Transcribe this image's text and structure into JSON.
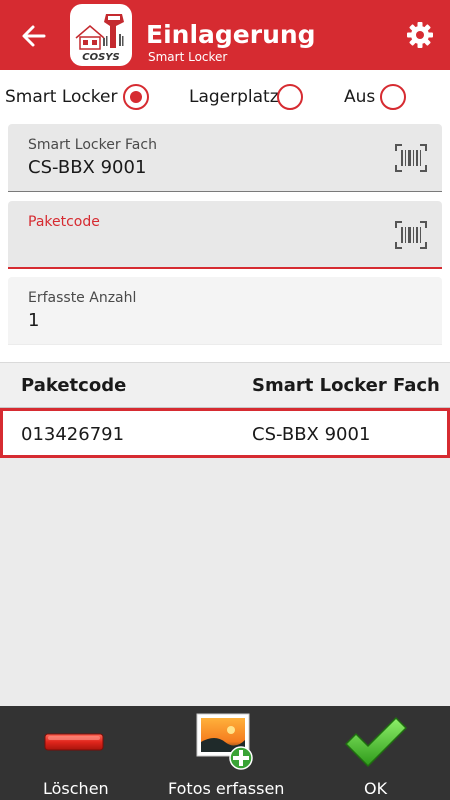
{
  "header": {
    "title": "Einlagerung",
    "subtitle": "Smart Locker",
    "logo_text": "COSYS",
    "color": "#d62b31"
  },
  "icons": {
    "back": "arrow-left-icon",
    "settings": "gear-icon",
    "scan": "barcode-scan-icon",
    "delete": "minus-bar-icon",
    "photo": "photo-add-icon",
    "ok": "checkmark-icon"
  },
  "mode": {
    "options": [
      {
        "label": "Smart Locker",
        "selected": true
      },
      {
        "label": "Lagerplatz",
        "selected": false
      },
      {
        "label": "Aus",
        "selected": false
      }
    ]
  },
  "fields": {
    "locker_compartment": {
      "label": "Smart Locker Fach",
      "value": "CS-BBX 9001"
    },
    "package_code": {
      "label": "Paketcode",
      "value": ""
    },
    "count": {
      "label": "Erfasste Anzahl",
      "value": "1"
    }
  },
  "table": {
    "columns": [
      "Paketcode",
      "Smart Locker Fach"
    ],
    "rows": [
      {
        "package_code": "013426791",
        "compartment": "CS-BBX 9001",
        "selected": true
      }
    ]
  },
  "bottom_bar": {
    "delete_label": "Löschen",
    "photos_label": "Fotos erfassen",
    "ok_label": "OK"
  }
}
